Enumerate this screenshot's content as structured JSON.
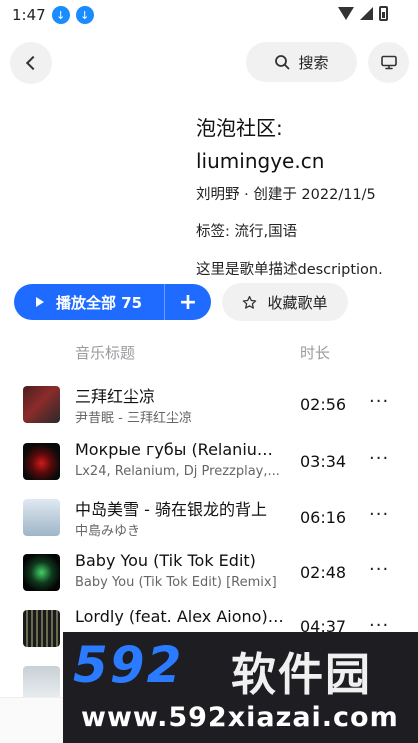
{
  "status_bar": {
    "time": "1:47",
    "download_icons": [
      "download-icon",
      "download-icon"
    ],
    "icons": [
      "wifi-icon",
      "signal-icon",
      "battery-icon"
    ]
  },
  "header": {
    "back_icon": "chevron-left-icon",
    "search_label": "搜索",
    "search_icon": "search-icon",
    "tv_icon": "monitor-icon"
  },
  "playlist": {
    "title": "泡泡社区: liumingye.cn",
    "meta": "刘明野 · 创建于 2022/11/5",
    "tags": "标签: 流行,国语",
    "description": "这里是歌单描述description."
  },
  "actions": {
    "play_all_label": "播放全部 75",
    "add_symbol": "+",
    "collect_label": "收藏歌单",
    "collect_icon": "star-icon"
  },
  "columns": {
    "title": "音乐标题",
    "duration": "时长"
  },
  "tracks": [
    {
      "name": "三拜红尘凉",
      "artist": "尹昔眠 - 三拜红尘凉",
      "duration": "02:56",
      "more": "···"
    },
    {
      "name": "Мокрые губы (Relanium, ...",
      "artist": "Lx24, Relanium, Dj Prezzplay,...",
      "duration": "03:34",
      "more": "···"
    },
    {
      "name": "中岛美雪 - 骑在银龙的背上",
      "artist": "中島みゆき",
      "duration": "06:16",
      "more": "···"
    },
    {
      "name": "Baby You (Tik Tok Edit)",
      "artist": "Baby You (Tik Tok Edit) [Remix]",
      "duration": "02:48",
      "more": "···"
    },
    {
      "name": "Lordly (feat. Alex Aiono) [...",
      "artist": "",
      "duration": "04:37",
      "more": "···"
    }
  ],
  "watermark": {
    "number": "592",
    "chinese": "软件园",
    "url": "www.592xiazai.com"
  }
}
